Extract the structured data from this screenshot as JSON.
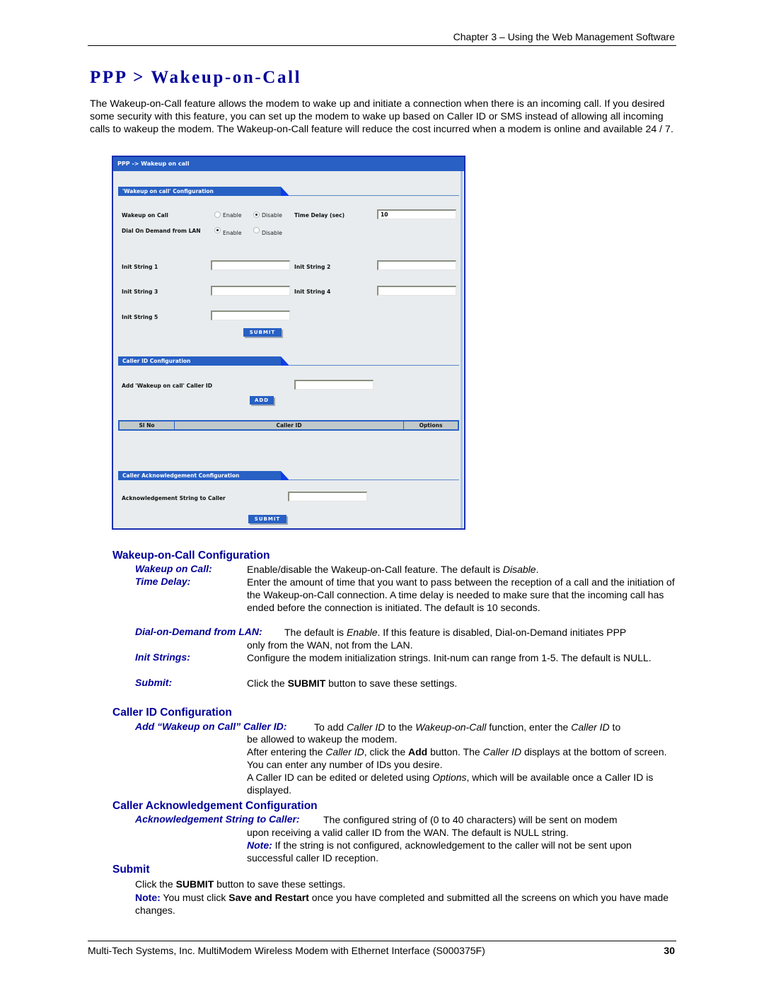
{
  "header": {
    "chapter": "Chapter 3 – Using the Web Management Software"
  },
  "title": "PPP > Wakeup-on-Call",
  "intro": "The Wakeup-on-Call feature allows the modem to wake up and initiate a connection when there is an incoming call. If you desired some security with this feature, you can set up the modem to wake up based on Caller ID or SMS instead of allowing all incoming calls to wakeup the modem. The Wakeup-on-Call feature will reduce the cost incurred when a modem is online and available 24 / 7.",
  "screenshot": {
    "titlebar": "PPP  ->  Wakeup on call",
    "wakeup_section": {
      "tab": "'Wakeup on call' Configuration",
      "wakeup_on_call": {
        "label": "Wakeup on Call",
        "options": [
          "Enable",
          "Disable"
        ],
        "selected": "Disable"
      },
      "time_delay": {
        "label": "Time Delay (sec)",
        "value": "10"
      },
      "dial_on_demand": {
        "label": "Dial On Demand from LAN",
        "options": [
          "Enable",
          "Disable"
        ],
        "selected": "Enable"
      },
      "init_strings": [
        {
          "label": "Init String 1",
          "value": ""
        },
        {
          "label": "Init String 2",
          "value": ""
        },
        {
          "label": "Init String 3",
          "value": ""
        },
        {
          "label": "Init String 4",
          "value": ""
        },
        {
          "label": "Init String 5",
          "value": ""
        }
      ],
      "submit_label": "SUBMIT"
    },
    "caller_id_section": {
      "tab": "Caller ID Configuration",
      "add_label": "Add 'Wakeup on call' Caller ID",
      "add_value": "",
      "add_button": "ADD",
      "table_headers": [
        "Sl No",
        "Caller ID",
        "Options"
      ],
      "rows": []
    },
    "ack_section": {
      "tab": "Caller Acknowledgement Configuration",
      "label": "Acknowledgement String to Caller",
      "value": "",
      "submit_label": "SUBMIT"
    }
  },
  "sections": {
    "wakeup_config": {
      "heading": "Wakeup-on-Call Configuration",
      "items": [
        {
          "term": "Wakeup on Call:",
          "desc_pre": "Enable/disable the Wakeup-on-Call feature. The default is ",
          "desc_em": "Disable",
          "desc_post": "."
        },
        {
          "term": "Time Delay:",
          "desc": "Enter the amount of time that you want to pass between the reception of a call and the initiation of the Wakeup-on-Call connection. A time delay is needed to make sure that the incoming call has ended before the connection is initiated. The default is 10 seconds."
        },
        {
          "term": "Dial-on-Demand from LAN:",
          "desc_pre": "The default is ",
          "desc_em": "Enable",
          "desc_post": ". If this feature is disabled, Dial-on-Demand initiates PPP",
          "desc_line2": "only from the WAN, not from the LAN."
        },
        {
          "term": "Init Strings:",
          "desc": "Configure the modem initialization strings. Init-num can range from 1-5. The default is NULL."
        },
        {
          "term": "Submit:",
          "desc_pre": "Click the ",
          "desc_bold": "SUBMIT",
          "desc_post": " button to save these settings."
        }
      ]
    },
    "caller_id_config": {
      "heading": "Caller ID Configuration",
      "term": "Add “Wakeup on Call” Caller ID:",
      "p1_a": "To add ",
      "p1_em1": "Caller ID",
      "p1_b": " to the ",
      "p1_em2": "Wakeup-on-Call",
      "p1_c": " function, enter the ",
      "p1_em3": "Caller ID",
      "p1_d": " to",
      "p1_line2": "be allowed to wakeup the modem.",
      "p2_a": "After entering the ",
      "p2_em1": "Caller ID",
      "p2_b": ", click the ",
      "p2_bold": "Add",
      "p2_c": " button. The ",
      "p2_em2": "Caller ID",
      "p2_d": " displays at the bottom of screen. You can enter any number of IDs you desire.",
      "p3_a": "A Caller ID can be edited or deleted using ",
      "p3_em": "Options",
      "p3_b": ", which will be available once a Caller ID is displayed."
    },
    "ack_config": {
      "heading": "Caller Acknowledgement Configuration",
      "term": "Acknowledgement String to Caller:",
      "p1_line1": "The configured string of (0 to 40 characters) will be sent on modem",
      "p1_line2": "upon receiving a valid caller ID from the WAN. The default is NULL string.",
      "note_label": "Note:",
      "note_text": " If the string is not configured, acknowledgement to the caller will not be sent upon successful caller ID reception."
    },
    "submit": {
      "heading": "Submit",
      "p1_pre": "Click the ",
      "p1_bold": "SUBMIT",
      "p1_post": " button to save these settings.",
      "note_label": "Note:",
      "note_pre": " You must click ",
      "note_bold": "Save and Restart",
      "note_post": " once you have completed and submitted all the screens on which you have made changes."
    }
  },
  "footer": {
    "text": "Multi-Tech Systems, Inc. MultiModem Wireless Modem with Ethernet Interface (S000375F)",
    "page": "30"
  }
}
